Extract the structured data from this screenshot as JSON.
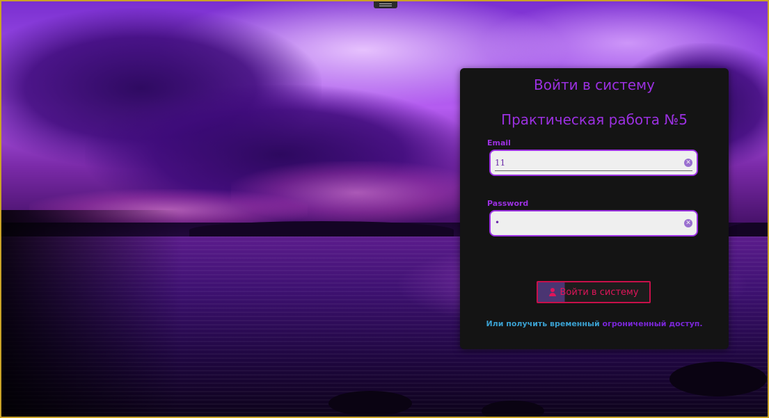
{
  "login": {
    "title": "Войти в систему",
    "subtitle": "Практическая работа №5",
    "email": {
      "label": "Email",
      "value": "11"
    },
    "password": {
      "label": "Password",
      "value": "•"
    },
    "submit_label": "Войти в систему",
    "footer": {
      "text": "Или получить временный",
      "link": "огрониченный доступ."
    }
  },
  "icons": {
    "clear": "clear-icon",
    "user": "user-icon"
  },
  "colors": {
    "accent": "#9b30e0",
    "button_text": "#e0155a",
    "footer_text": "#3aa0d0",
    "link": "#7a26d8",
    "card_bg": "#141414",
    "frame_border": "#c9a227"
  }
}
